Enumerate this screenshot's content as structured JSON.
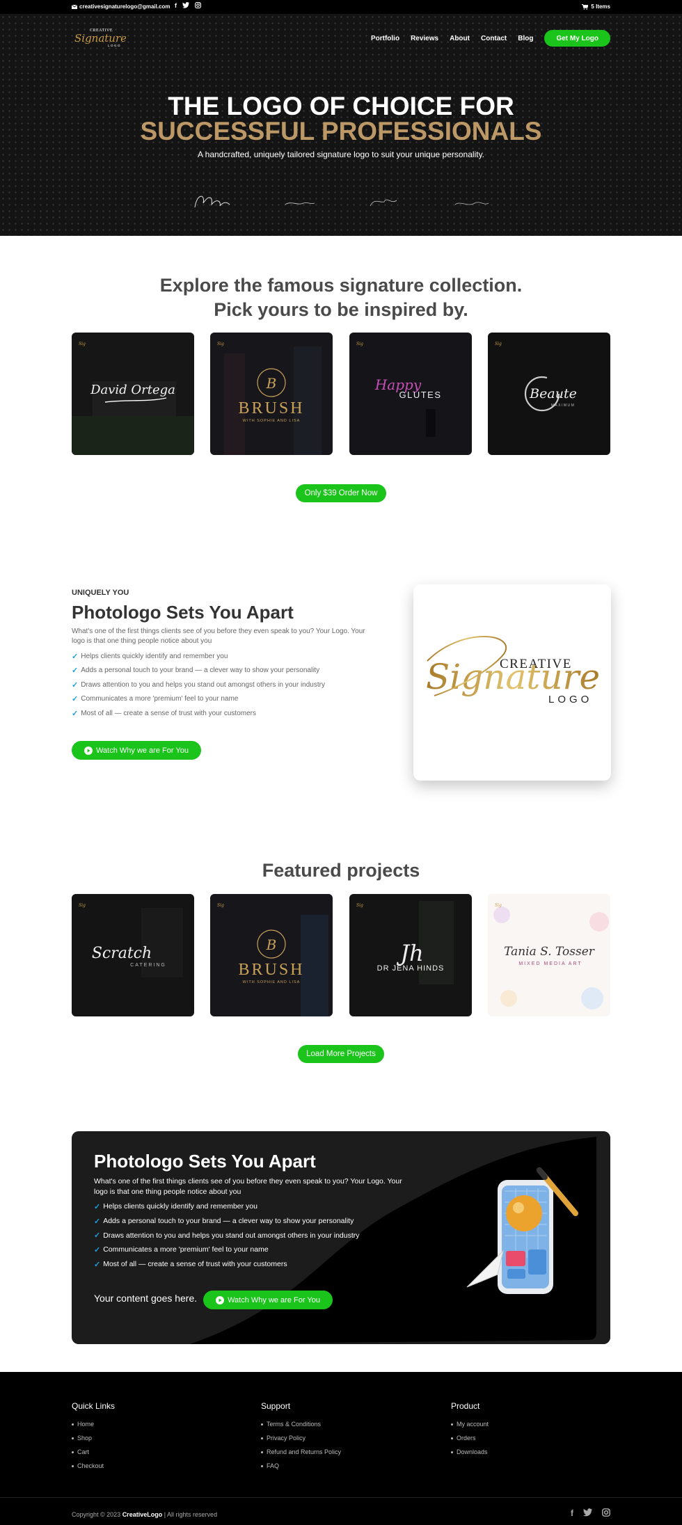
{
  "topbar": {
    "email": "creativesignaturelogo@gmail.com",
    "cart": "5 Items",
    "social": [
      "facebook-icon",
      "twitter-icon",
      "instagram-icon"
    ]
  },
  "logo": {
    "line1": "CREATIVE",
    "script": "Signature",
    "line3": "LOGO"
  },
  "nav": {
    "items": [
      "Portfolio",
      "Reviews",
      "About",
      "Contact",
      "Blog"
    ],
    "cta": "Get My Logo"
  },
  "hero": {
    "title_line1": "THE LOGO OF CHOICE FOR",
    "title_line2": "SUCCESSFUL PROFESSIONALS",
    "subtitle": "A handcrafted, uniquely tailored signature logo to suit your unique personality."
  },
  "collection": {
    "title_line1": "Explore the famous signature collection.",
    "title_line2": "Pick yours to be inspired by.",
    "tiles": [
      {
        "script": "David Ortega",
        "sub": ""
      },
      {
        "script": "B",
        "word": "BRUSH",
        "sub": "WITH SOPHIE AND LISA"
      },
      {
        "script": "Happy",
        "word": "GLUTES",
        "sub": ""
      },
      {
        "script": "Beaute",
        "word": "",
        "sub": "MAXIMUM"
      }
    ],
    "cta": "Only $39 Order Now"
  },
  "apart": {
    "eyebrow": "UNIQUELY YOU",
    "title": "Photologo Sets You Apart",
    "paragraph": "What's one of the first things clients see of you before they even speak to you? Your Logo. Your logo is that one thing people notice about you",
    "bullets": [
      "Helps clients quickly identify and remember you",
      "Adds a personal touch to your brand — a clever way to show your personality",
      "Draws attention to you and helps you stand out amongst others in your industry",
      "Communicates a more 'premium' feel to your name",
      "Most of all — create a sense of trust with your customers"
    ],
    "cta": "Watch Why we are For You",
    "card": {
      "line1": "CREATIVE",
      "script": "Signature",
      "line3": "LOGO"
    }
  },
  "featured": {
    "title": "Featured projects",
    "tiles": [
      {
        "script": "Scratch",
        "sub": "CATERING"
      },
      {
        "script": "B",
        "word": "BRUSH",
        "sub": "WITH SOPHIE AND LISA"
      },
      {
        "script": "Jh",
        "word": "DR JENA  HINDS",
        "sub": ""
      },
      {
        "script": "Tania S. Tosser",
        "sub": "MIXED MEDIA ART"
      }
    ],
    "cta": "Load More Projects"
  },
  "promo": {
    "title": "Photologo Sets You Apart",
    "paragraph": "What's one of the first things clients see of you before they even speak to you? Your Logo. Your logo is that one thing people notice about you",
    "bullets": [
      "Helps clients quickly identify and remember you",
      "Adds a personal touch to your brand — a clever way to show your personality",
      "Draws attention to you and helps you stand out amongst others in your industry",
      "Communicates a more 'premium' feel to your name",
      "Most of all — create a sense of trust with your customers"
    ],
    "content": "Your content goes here.",
    "cta": "Watch Why we are For You"
  },
  "footer": {
    "quick_links": {
      "title": "Quick Links",
      "items": [
        "Home",
        "Shop",
        "Cart",
        "Checkout"
      ]
    },
    "support": {
      "title": "Support",
      "items": [
        "Terms & Conditions",
        "Privacy Policy",
        "Refund and Returns Policy",
        "FAQ"
      ]
    },
    "product": {
      "title": "Product",
      "items": [
        "My account",
        "Orders",
        "Downloads"
      ]
    },
    "copyright_pre": "Copyright © 2023 ",
    "copyright_brand": "CreativeLogo",
    "copyright_post": " | All rights reserved",
    "social": [
      "facebook-icon",
      "twitter-icon",
      "instagram-icon"
    ]
  },
  "colors": {
    "accent": "#1ac41a",
    "gold": "#bd9867",
    "dark": "#141414",
    "check": "#1a9fe0"
  }
}
